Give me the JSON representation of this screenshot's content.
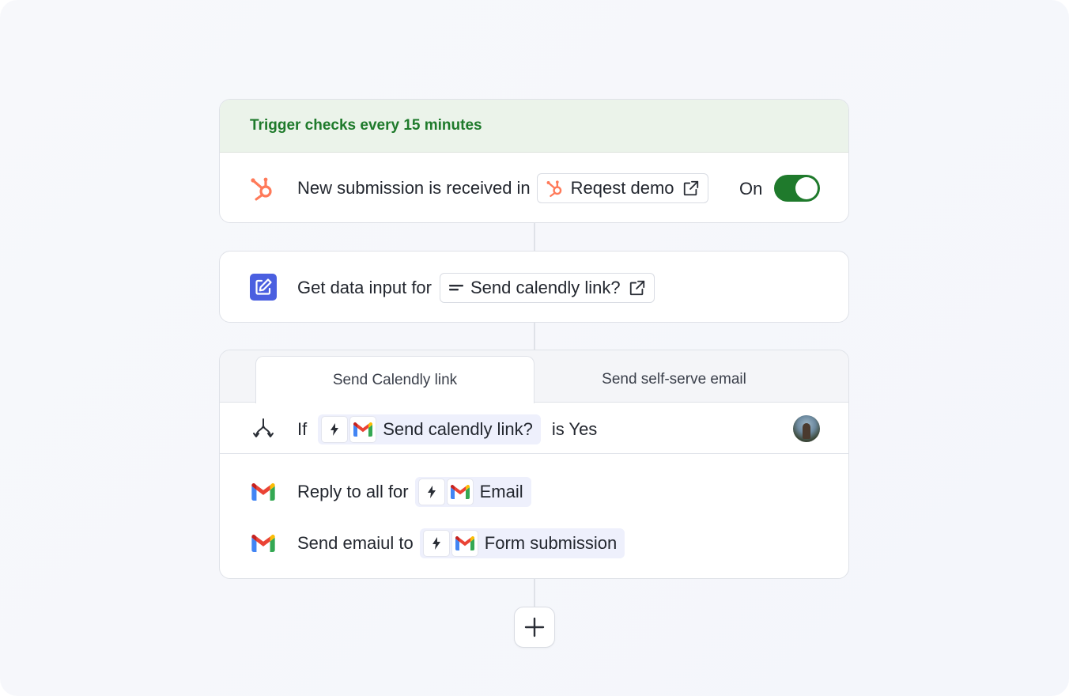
{
  "trigger": {
    "banner": "Trigger checks every 15 minutes",
    "text": "New submission is received in",
    "form_name": "Reqest demo",
    "toggle_label": "On",
    "toggle_on": true,
    "app_icon": "hubspot-icon"
  },
  "data_input": {
    "text": "Get data input for",
    "field_name": "Send calendly link?",
    "app_icon": "edit-icon"
  },
  "branch": {
    "tabs": [
      {
        "label": "Send Calendly link",
        "active": true
      },
      {
        "label": "Send self-serve email",
        "active": false
      }
    ],
    "condition": {
      "prefix": "If",
      "variable": "Send calendly link?",
      "suffix": "is Yes"
    },
    "actions": [
      {
        "text": "Reply to all for",
        "variable": "Email",
        "app_icon": "gmail-icon"
      },
      {
        "text": "Send emaiul to",
        "variable": "Form submission",
        "app_icon": "gmail-icon"
      }
    ]
  },
  "colors": {
    "hubspot": "#ff7a59",
    "toggle_on": "#1f7a2c",
    "banner_text": "#1e7a2b",
    "banner_bg": "#ebf3ea",
    "edit_icon_bg": "#4a5fe0",
    "variable_bg": "#eef0fc"
  }
}
